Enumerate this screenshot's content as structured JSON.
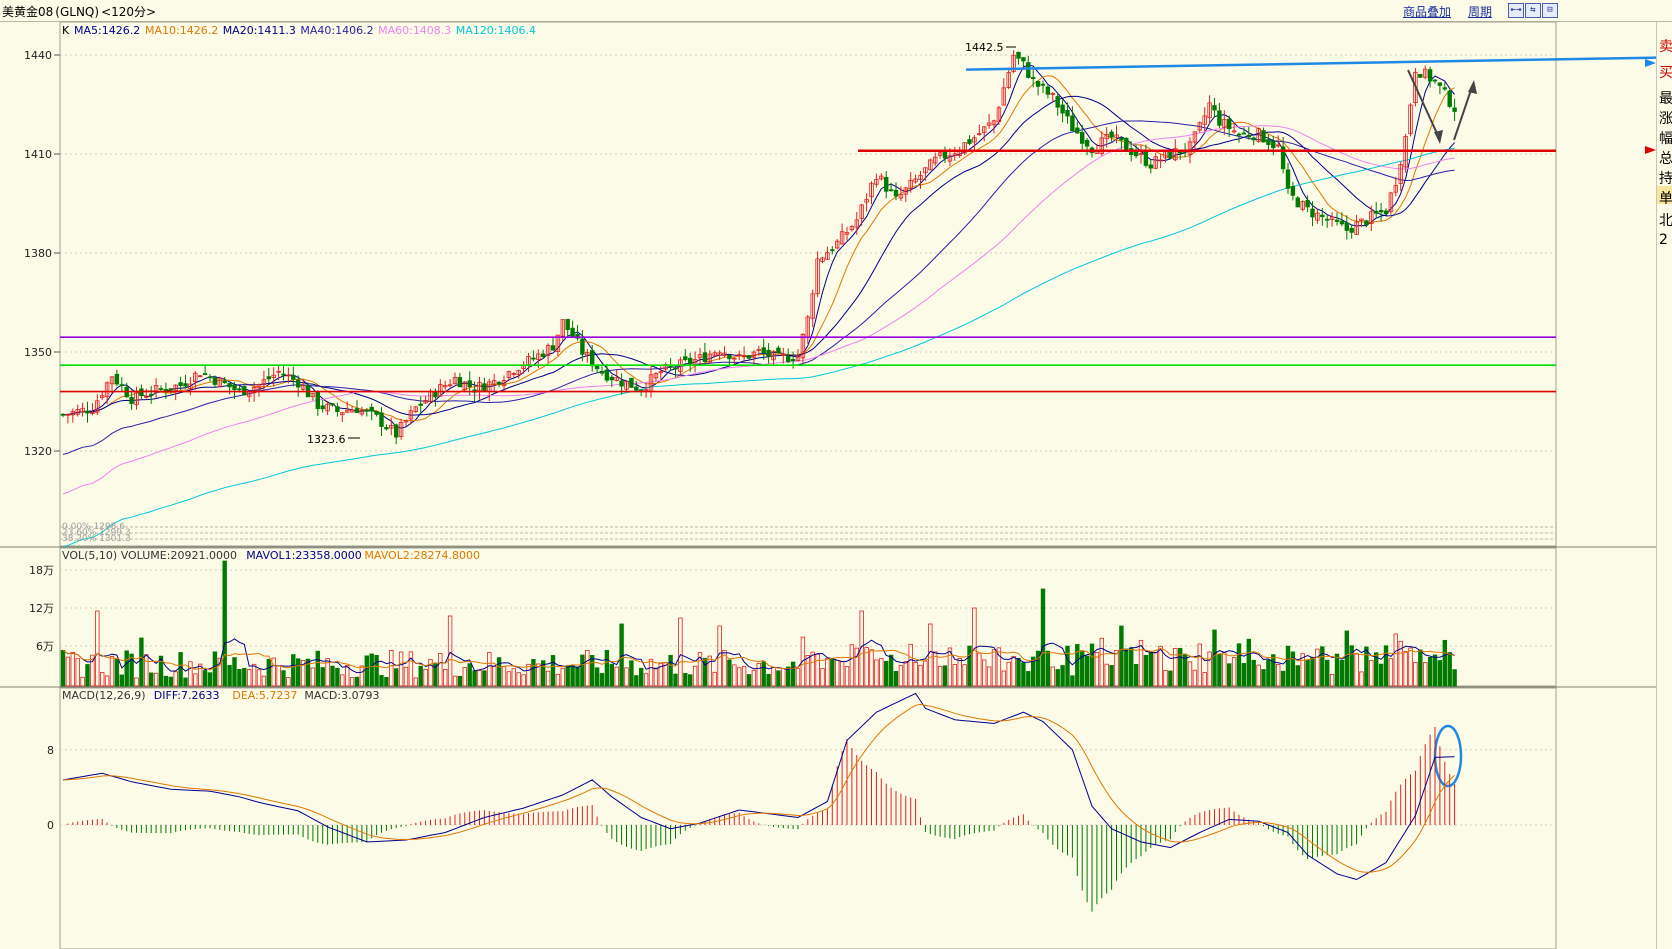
{
  "header": {
    "instrument": "美黄金08",
    "code": "(GLNQ)",
    "period": "<120分>",
    "overlay_link": "商品叠加",
    "cycle_link": "周期",
    "nav_buttons": [
      "⇤⇥",
      "⇆",
      "⊟"
    ]
  },
  "price_panel": {
    "indicator_label": "K",
    "ma_legend": [
      {
        "text": "MA5:1426.2",
        "color": "#00008b"
      },
      {
        "text": "MA10:1426.2",
        "color": "#e07800"
      },
      {
        "text": "MA20:1411.3",
        "color": "#00008b"
      },
      {
        "text": "MA40:1406.2",
        "color": "#2a1fa8"
      },
      {
        "text": "MA60:1408.3",
        "color": "#ee82ee"
      },
      {
        "text": "MA120:1406.4",
        "color": "#00c8d8"
      }
    ],
    "y_ticks": [
      "1440",
      "1410",
      "1380",
      "1350",
      "1320"
    ],
    "y_tick_values": [
      1440,
      1410,
      1380,
      1350,
      1320
    ],
    "high_annotation": "1442.5",
    "low_annotation": "1323.6",
    "footer_notes": [
      "0.00% 1298.6",
      "23.60% 1299.3",
      "38.20% 1301.3"
    ],
    "colors": {
      "up": "#e02020",
      "down": "#007a00",
      "bg": "#fcfbe8",
      "grid": "#cfcfbf"
    }
  },
  "volume_panel": {
    "legend": [
      {
        "text": "VOL(5,10) VOLUME:20921.0000",
        "color": "#333333"
      },
      {
        "text": "MAVOL1:23358.0000",
        "color": "#00008b"
      },
      {
        "text": "MAVOL2:28274.8000",
        "color": "#e07800"
      }
    ],
    "y_ticks": [
      "18万",
      "12万",
      "6万"
    ],
    "right_edge_label": "2"
  },
  "macd_panel": {
    "legend": [
      {
        "text": "MACD(12,26,9)",
        "color": "#333333"
      },
      {
        "text": "DIFF:7.2633",
        "color": "#00008b"
      },
      {
        "text": "DEA:5.7237",
        "color": "#e07800"
      },
      {
        "text": "MACD:3.0793",
        "color": "#333333"
      }
    ],
    "y_ticks": [
      "8",
      "0"
    ]
  },
  "right_panel_chars": [
    "卖",
    "买",
    "最",
    "涨",
    "幅",
    "总",
    "持",
    "单",
    "北",
    "2"
  ],
  "chart_data": {
    "type": "candlestick",
    "instrument": "美黄金08 (GLNQ)",
    "period": "120分",
    "ylim": [
      1301,
      1450
    ],
    "horizontal_lines": [
      {
        "value": 1354.5,
        "color": "#9b00e0"
      },
      {
        "value": 1346,
        "color": "#00e000"
      },
      {
        "value": 1338,
        "color": "#e00000"
      },
      {
        "value": 1411,
        "color": "#e00000"
      }
    ],
    "trendline": {
      "from": 1438,
      "to": 1439.5,
      "color": "#1e88e5"
    },
    "price_waypoints": [
      [
        0,
        1331
      ],
      [
        6,
        1333
      ],
      [
        10,
        1343
      ],
      [
        14,
        1336
      ],
      [
        18,
        1338
      ],
      [
        24,
        1340
      ],
      [
        28,
        1344
      ],
      [
        32,
        1341
      ],
      [
        36,
        1338
      ],
      [
        40,
        1340
      ],
      [
        44,
        1344
      ],
      [
        48,
        1341
      ],
      [
        52,
        1334
      ],
      [
        56,
        1332
      ],
      [
        60,
        1333
      ],
      [
        64,
        1330
      ],
      [
        68,
        1325
      ],
      [
        72,
        1333
      ],
      [
        76,
        1338
      ],
      [
        80,
        1342
      ],
      [
        84,
        1339
      ],
      [
        88,
        1341
      ],
      [
        92,
        1345
      ],
      [
        96,
        1348
      ],
      [
        100,
        1352
      ],
      [
        102,
        1359
      ],
      [
        104,
        1355
      ],
      [
        106,
        1350
      ],
      [
        110,
        1344
      ],
      [
        114,
        1341
      ],
      [
        118,
        1339
      ],
      [
        122,
        1344
      ],
      [
        126,
        1346
      ],
      [
        130,
        1348
      ],
      [
        134,
        1351
      ],
      [
        138,
        1348
      ],
      [
        142,
        1350
      ],
      [
        146,
        1348
      ],
      [
        150,
        1349
      ],
      [
        152,
        1360
      ],
      [
        154,
        1378
      ],
      [
        158,
        1383
      ],
      [
        162,
        1390
      ],
      [
        166,
        1404
      ],
      [
        170,
        1396
      ],
      [
        174,
        1402
      ],
      [
        178,
        1408
      ],
      [
        182,
        1411
      ],
      [
        186,
        1415
      ],
      [
        190,
        1420
      ],
      [
        192,
        1430
      ],
      [
        194,
        1440
      ],
      [
        196,
        1437
      ],
      [
        198,
        1432
      ],
      [
        202,
        1427
      ],
      [
        206,
        1418
      ],
      [
        210,
        1412
      ],
      [
        214,
        1415
      ],
      [
        218,
        1411
      ],
      [
        222,
        1407
      ],
      [
        226,
        1410
      ],
      [
        230,
        1412
      ],
      [
        232,
        1418
      ],
      [
        234,
        1425
      ],
      [
        236,
        1420
      ],
      [
        240,
        1416
      ],
      [
        244,
        1416
      ],
      [
        248,
        1412
      ],
      [
        250,
        1398
      ],
      [
        254,
        1393
      ],
      [
        258,
        1390
      ],
      [
        262,
        1387
      ],
      [
        266,
        1390
      ],
      [
        270,
        1393
      ],
      [
        272,
        1402
      ],
      [
        274,
        1415
      ],
      [
        276,
        1436
      ],
      [
        280,
        1432
      ],
      [
        282,
        1428
      ],
      [
        284,
        1424
      ]
    ],
    "volume_spikes": [
      [
        7,
        75
      ],
      [
        16,
        48
      ],
      [
        33,
        125
      ],
      [
        79,
        70
      ],
      [
        114,
        62
      ],
      [
        126,
        68
      ],
      [
        134,
        60
      ],
      [
        163,
        75
      ],
      [
        177,
        62
      ],
      [
        186,
        78
      ],
      [
        200,
        97
      ],
      [
        216,
        60
      ],
      [
        235,
        56
      ],
      [
        262,
        55
      ],
      [
        272,
        52
      ]
    ],
    "macd_waypoints": [
      [
        0,
        4.8
      ],
      [
        8,
        5.5
      ],
      [
        14,
        4.6
      ],
      [
        22,
        3.8
      ],
      [
        30,
        3.6
      ],
      [
        36,
        3.0
      ],
      [
        40,
        2.4
      ],
      [
        48,
        1.5
      ],
      [
        54,
        -0.2
      ],
      [
        62,
        -1.8
      ],
      [
        70,
        -1.6
      ],
      [
        78,
        -0.8
      ],
      [
        86,
        0.8
      ],
      [
        94,
        1.8
      ],
      [
        102,
        3.2
      ],
      [
        108,
        4.8
      ],
      [
        112,
        3.0
      ],
      [
        118,
        0.8
      ],
      [
        124,
        -0.4
      ],
      [
        130,
        0.2
      ],
      [
        138,
        1.6
      ],
      [
        144,
        1.2
      ],
      [
        150,
        0.8
      ],
      [
        156,
        2.5
      ],
      [
        160,
        9
      ],
      [
        166,
        12
      ],
      [
        170,
        13
      ],
      [
        174,
        14
      ],
      [
        176,
        12.4
      ],
      [
        182,
        11.2
      ],
      [
        190,
        10.8
      ],
      [
        196,
        12
      ],
      [
        200,
        11
      ],
      [
        206,
        8
      ],
      [
        210,
        2
      ],
      [
        214,
        -0.4
      ],
      [
        220,
        -1.8
      ],
      [
        226,
        -2.4
      ],
      [
        232,
        -0.8
      ],
      [
        238,
        0.6
      ],
      [
        244,
        0.4
      ],
      [
        250,
        -0.8
      ],
      [
        254,
        -3.2
      ],
      [
        260,
        -5.2
      ],
      [
        264,
        -5.8
      ],
      [
        270,
        -4
      ],
      [
        276,
        1
      ],
      [
        280,
        7.2
      ],
      [
        284,
        7.26
      ]
    ]
  }
}
